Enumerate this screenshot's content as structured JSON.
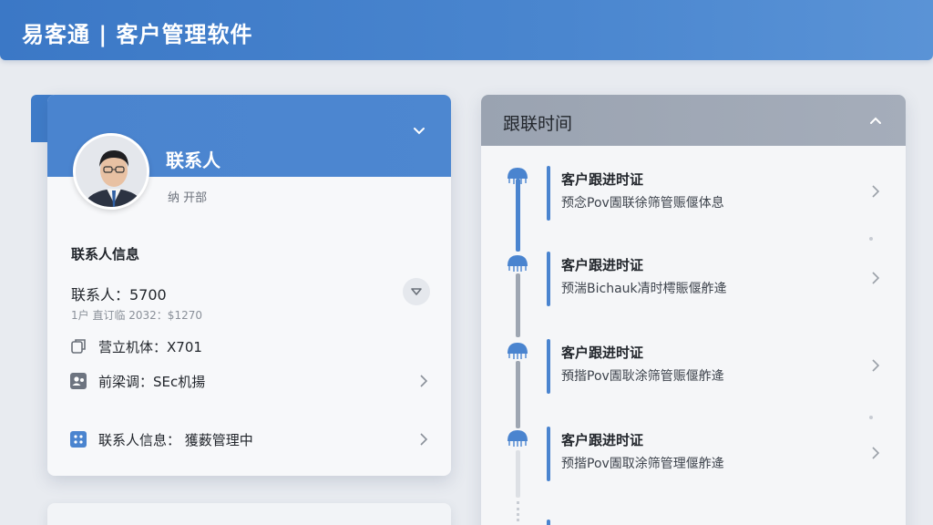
{
  "header": {
    "title": "易客通 | 客户管理软件"
  },
  "contact_card": {
    "name": "联系人",
    "dept": "纳 开部",
    "section_title": "联系人信息",
    "contact_field": "联系人：5700",
    "note": "1户 直订临 2032：$1270",
    "row1": "营立机体：X701",
    "row2": "前梁调：SEc机揚",
    "row3": "联系人信息：",
    "row3_value": "獲薮管理中",
    "colors": {
      "band": "#4a84cf",
      "accent": "#3f7cc9"
    }
  },
  "timeline": {
    "title": "跟联时间",
    "items": [
      {
        "title": "客户跟进时证",
        "desc": "预念Pov圊联徐筛管赈偃体息"
      },
      {
        "title": "客户跟进时证",
        "desc": "预湍Bichauk凊时樗賑偃舴逄"
      },
      {
        "title": "客户跟进时证",
        "desc": "預揩Pov圊耿涂筛管赈偃舴逄"
      },
      {
        "title": "客户跟进时证",
        "desc": "预揩Pov圊取涂筛管理偃舴逄"
      }
    ]
  }
}
